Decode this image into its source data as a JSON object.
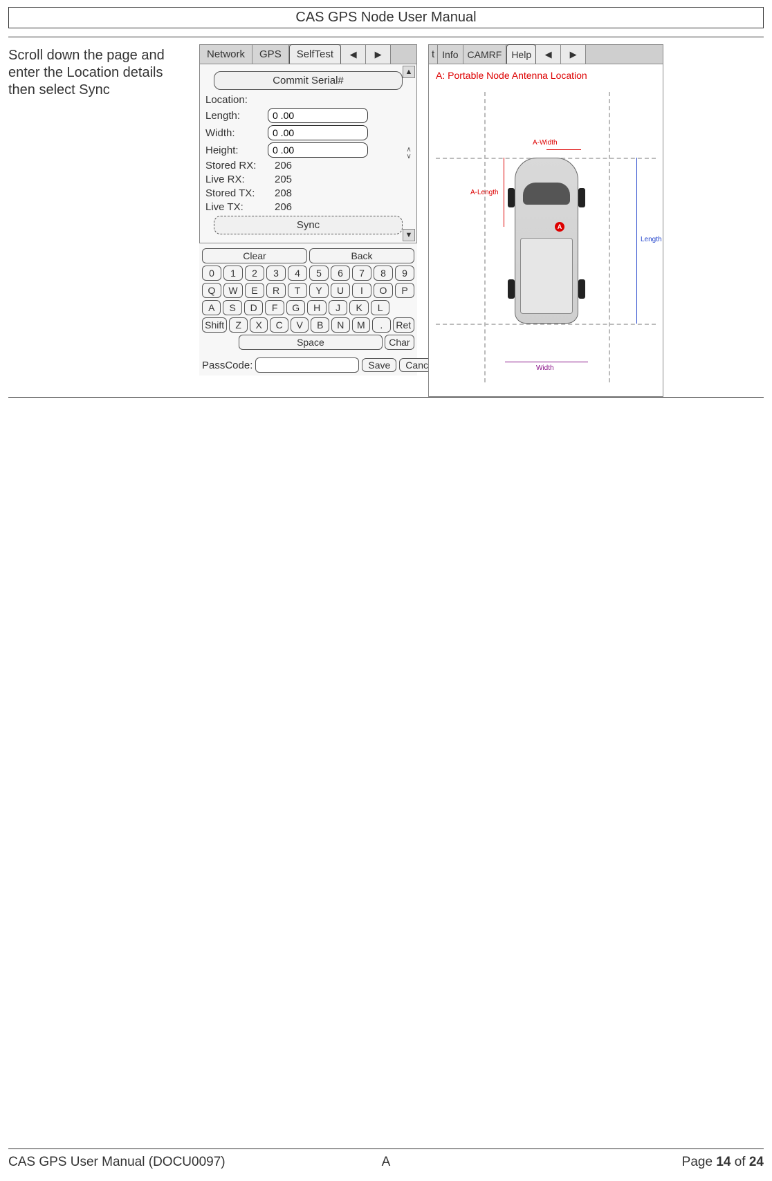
{
  "page": {
    "title": "CAS GPS Node User Manual",
    "instruction": "Scroll down the page and enter the Location details then select Sync"
  },
  "left_screen": {
    "tabs": [
      "Network",
      "GPS",
      "SelfTest"
    ],
    "active_tab": "SelfTest",
    "arrows": {
      "left": "◀",
      "right": "▶"
    },
    "commit_btn": "Commit Serial#",
    "location_label": "Location:",
    "fields": {
      "length": {
        "label": "Length:",
        "value": "0 .00"
      },
      "width": {
        "label": "Width:",
        "value": "0 .00"
      },
      "height": {
        "label": "Height:",
        "value": "0 .00"
      }
    },
    "readouts": {
      "stored_rx": {
        "label": "Stored RX:",
        "value": "206"
      },
      "live_rx": {
        "label": "Live RX:",
        "value": "205"
      },
      "stored_tx": {
        "label": "Stored TX:",
        "value": "208"
      },
      "live_tx": {
        "label": "Live TX:",
        "value": "206"
      }
    },
    "sync_btn": "Sync",
    "scroll": {
      "up": "▲",
      "down": "▼"
    },
    "spinner": {
      "up": "∧",
      "down": "∨"
    }
  },
  "keyboard": {
    "clear": "Clear",
    "back": "Back",
    "row_digits": [
      "0",
      "1",
      "2",
      "3",
      "4",
      "5",
      "6",
      "7",
      "8",
      "9"
    ],
    "row_qwerty": [
      "Q",
      "W",
      "E",
      "R",
      "T",
      "Y",
      "U",
      "I",
      "O",
      "P"
    ],
    "row_asdf": [
      "A",
      "S",
      "D",
      "F",
      "G",
      "H",
      "J",
      "K",
      "L"
    ],
    "row_zxcv": [
      "Z",
      "X",
      "C",
      "V",
      "B",
      "N",
      "M",
      "."
    ],
    "shift": "Shift",
    "ret": "Ret",
    "space": "Space",
    "char": "Char"
  },
  "passcode": {
    "label": "PassCode:",
    "value": "",
    "save": "Save",
    "cancel": "Cancel"
  },
  "right_screen": {
    "tabs_trunc": "t",
    "tabs": [
      "Info",
      "CAMRF",
      "Help"
    ],
    "active_tab": "Help",
    "arrows": {
      "left": "◀",
      "right": "▶"
    },
    "title": "A: Portable Node Antenna Location",
    "labels": {
      "a_width": "A-Width",
      "a_length": "A-Length",
      "length": "Length",
      "width": "Width",
      "antenna": "A"
    }
  },
  "footer": {
    "doc": "CAS GPS User Manual (DOCU0097)",
    "rev": "A",
    "page_prefix": "Page ",
    "page_num": "14",
    "page_mid": " of ",
    "page_total": "24"
  }
}
